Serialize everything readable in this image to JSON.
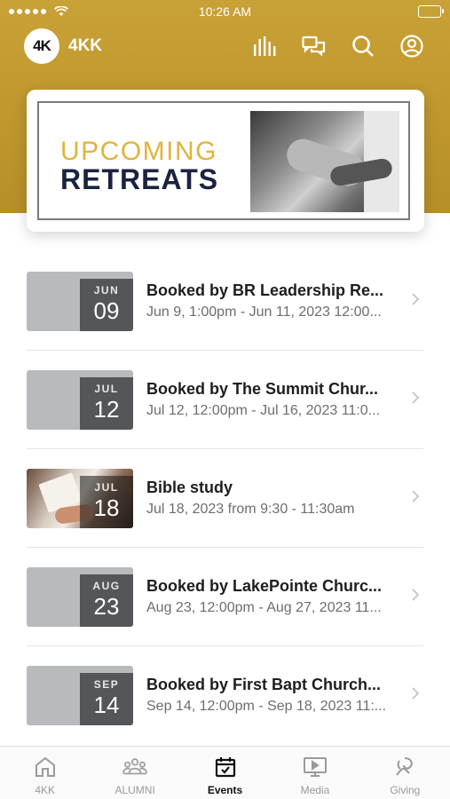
{
  "status_bar": {
    "time": "10:26 AM"
  },
  "header": {
    "logo_text": "4K",
    "app_name": "4KK",
    "icons": [
      "stats-icon",
      "chat-icon",
      "search-icon",
      "profile-icon"
    ]
  },
  "banner": {
    "line1": "UPCOMING",
    "line2": "RETREATS",
    "accent_color": "#e0b43a",
    "title_color": "#1a2340"
  },
  "events": [
    {
      "month": "JUN",
      "day": "09",
      "title": "Booked by BR Leadership Re...",
      "subtitle": "Jun 9, 1:00pm - Jun 11, 2023 12:00...",
      "thumb": "plain"
    },
    {
      "month": "JUL",
      "day": "12",
      "title": "Booked by The Summit Chur...",
      "subtitle": "Jul 12, 12:00pm - Jul 16, 2023 11:0...",
      "thumb": "plain"
    },
    {
      "month": "JUL",
      "day": "18",
      "title": "Bible study",
      "subtitle": "Jul 18, 2023 from 9:30 - 11:30am",
      "thumb": "photo"
    },
    {
      "month": "AUG",
      "day": "23",
      "title": "Booked by LakePointe Churc...",
      "subtitle": "Aug 23, 12:00pm - Aug 27, 2023 11...",
      "thumb": "plain"
    },
    {
      "month": "SEP",
      "day": "14",
      "title": "Booked by First Bapt Church...",
      "subtitle": "Sep 14, 12:00pm - Sep 18, 2023 11:...",
      "thumb": "plain"
    }
  ],
  "tabs": [
    {
      "label": "4KK",
      "icon": "home-icon",
      "active": false
    },
    {
      "label": "ALUMNI",
      "icon": "group-icon",
      "active": false
    },
    {
      "label": "Events",
      "icon": "calendar-icon",
      "active": true
    },
    {
      "label": "Media",
      "icon": "media-icon",
      "active": false
    },
    {
      "label": "Giving",
      "icon": "giving-icon",
      "active": false
    }
  ],
  "colors": {
    "header_gold": "#c9a237",
    "date_box": "#555659"
  }
}
